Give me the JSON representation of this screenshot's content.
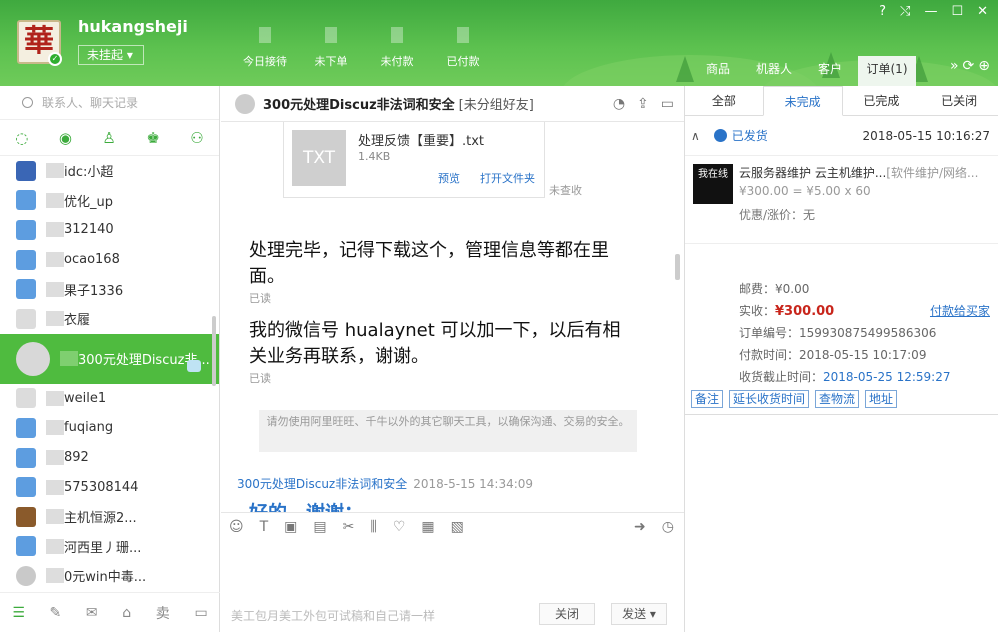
{
  "header": {
    "username": "hukangsheji",
    "status": "未挂起",
    "logo_char": "華",
    "stats": [
      "今日接待",
      "未下单",
      "未付款",
      "已付款"
    ],
    "window_controls": [
      "?",
      "⤭",
      "—",
      "☐",
      "✕"
    ],
    "top_tabs": [
      "商品",
      "机器人",
      "客户",
      "订单"
    ],
    "order_badge": "(1)"
  },
  "left": {
    "search_placeholder": "联系人、聊天记录",
    "contacts": [
      {
        "name": "idc:小超"
      },
      {
        "name": "优化_up"
      },
      {
        "name": "312140"
      },
      {
        "name": "ocao168"
      },
      {
        "name": "果子1336"
      },
      {
        "name": "衣履"
      },
      {
        "name": "300元处理Discuz非..."
      },
      {
        "name": "weile1"
      },
      {
        "name": "fuqiang"
      },
      {
        "name": "892"
      },
      {
        "name": "575308144"
      },
      {
        "name": "主机恒源2..."
      },
      {
        "name": "河西里丿珊..."
      },
      {
        "name": "0元win中毒..."
      }
    ]
  },
  "chat": {
    "title": "300元处理Discuz非法词和安全",
    "subtitle": "[未分组好友]",
    "file": {
      "type": "TXT",
      "name": "处理反馈【重要】.txt",
      "size": "1.4KB",
      "preview": "预览",
      "open": "打开文件夹",
      "state": "未查收"
    },
    "msg1": "处理完毕，记得下载这个，管理信息等都在里面。",
    "msg2": "我的微信号 hualaynet 可以加一下，以后有相关业务再联系，谢谢。",
    "read_label": "已读",
    "notice": "请勿使用阿里旺旺、千牛以外的其它聊天工具，以确保沟通、交易的安全。",
    "sender": "300元处理Discuz非法词和安全",
    "sender_time": "2018-5-15 14:34:09",
    "reply": "好的，谢谢；",
    "input_hint": "美工包月美工外包可试稿和自己请一样",
    "close_label": "关闭",
    "send_label": "发送 ▾"
  },
  "order": {
    "tabs": [
      "全部",
      "未完成",
      "已完成",
      "已关闭"
    ],
    "ship_status": "已发货",
    "ship_time": "2018-05-15 10:16:27",
    "product_title": "云服务器维护 云主机维护...",
    "product_tag": "[软件维护/网络...",
    "product_price": "¥300.00 = ¥5.00 x 60",
    "product_img_text": "我在线",
    "discount_label": "优惠/涨价：",
    "discount_value": "无",
    "postage": "邮费：¥0.00",
    "paid_label": "实收：",
    "paid_value": "¥300.00",
    "order_no": "订单编号：1599308754995863​06",
    "pay_time": "付款时间：2018-05-15 10:17:09",
    "deadline_label": "收货截止时间：",
    "deadline_value": "2018-05-25 12:59:27",
    "pay_link": "付款给买家",
    "buttons": [
      "备注",
      "延长收货时间",
      "查物流",
      "地址"
    ]
  }
}
